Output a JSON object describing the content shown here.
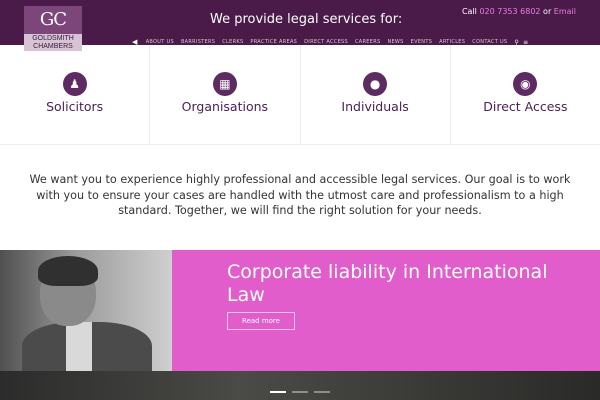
{
  "logo": {
    "mark": "GC",
    "line1": "GOLDSMITH",
    "line2": "CHAMBERS"
  },
  "header": {
    "tagline": "We provide legal services for:",
    "contact_prefix": "Call ",
    "phone": "020 7353 6802",
    "contact_or": " or ",
    "email_label": "Email"
  },
  "nav": {
    "items": [
      "ABOUT US",
      "BARRISTERS",
      "CLERKS",
      "PRACTICE AREAS",
      "DIRECT ACCESS",
      "CAREERS",
      "NEWS",
      "EVENTS",
      "ARTICLES",
      "CONTACT US"
    ],
    "icons": [
      "back-arrow-icon",
      "search-icon",
      "menu-icon"
    ]
  },
  "services": [
    {
      "label": "Solicitors",
      "icon": "user-tie-icon"
    },
    {
      "label": "Organisations",
      "icon": "org-chart-icon"
    },
    {
      "label": "Individuals",
      "icon": "person-icon"
    },
    {
      "label": "Direct Access",
      "icon": "globe-icon"
    }
  ],
  "intro": "We want you to experience highly professional and accessible legal services. Our goal is to work with you to ensure your cases are handled with the utmost care and professionalism to a high standard. Together, we will find the right solution for your needs.",
  "feature": {
    "title": "Corporate liability in International Law",
    "button": "Read more"
  },
  "colors": {
    "header_bg": "#4a1b49",
    "accent_pink": "#e25dcc",
    "icon_purple": "#5d2a62",
    "link_pink": "#e77ee4"
  },
  "slider": {
    "count": 3,
    "active_index": 0
  }
}
